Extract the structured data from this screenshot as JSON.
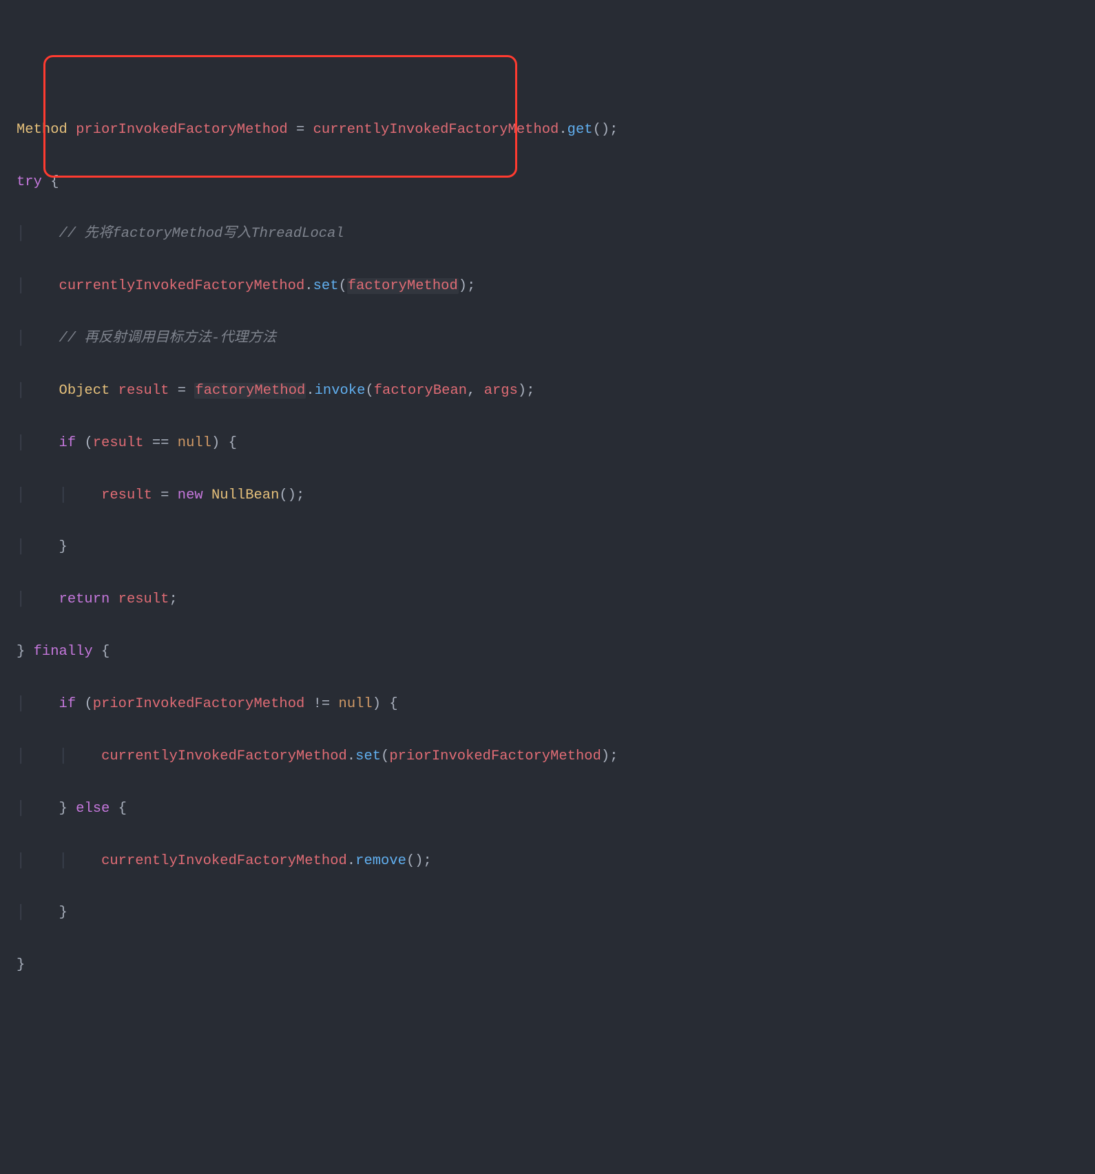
{
  "code": {
    "line1": {
      "type": "Method",
      "ident": "priorInvokedFactoryMethod",
      "eq": " = ",
      "obj": "currentlyInvokedFactoryMethod",
      "dot": ".",
      "method": "get",
      "call": "();"
    },
    "line2": {
      "kw": "try",
      "brace": " {"
    },
    "line3": {
      "comment": "// 先将factoryMethod写入ThreadLocal"
    },
    "line4": {
      "obj": "currentlyInvokedFactoryMethod",
      "dot": ".",
      "method": "set",
      "open": "(",
      "param": "factoryMethod",
      "close": ");"
    },
    "line5": {
      "comment": "// 再反射调用目标方法-代理方法"
    },
    "line6": {
      "type": "Object",
      "ident": "result",
      "eq": " = ",
      "obj": "factoryMethod",
      "dot": ".",
      "method": "invoke",
      "open": "(",
      "p1": "factoryBean",
      "comma": ", ",
      "p2": "args",
      "close": ");"
    },
    "line7": {
      "kw": "if",
      "open": " (",
      "ident": "result",
      "op": " == ",
      "null": "null",
      "close": ") {"
    },
    "line8": {
      "ident": "result",
      "eq": " = ",
      "new": "new",
      "sp": " ",
      "ctor": "NullBean",
      "call": "();"
    },
    "line9": {
      "brace": "}"
    },
    "line10": {
      "kw": "return",
      "sp": " ",
      "ident": "result",
      "semi": ";"
    },
    "line11": {
      "close": "}",
      "sp": " ",
      "kw": "finally",
      "brace": " {"
    },
    "line12": {
      "kw": "if",
      "open": " (",
      "ident": "priorInvokedFactoryMethod",
      "op": " != ",
      "null": "null",
      "close": ") {"
    },
    "line13": {
      "obj": "currentlyInvokedFactoryMethod",
      "dot": ".",
      "method": "set",
      "open": "(",
      "param": "priorInvokedFactoryMethod",
      "close": ");"
    },
    "line14": {
      "close": "}",
      "sp": " ",
      "kw": "else",
      "brace": " {"
    },
    "line15": {
      "obj": "currentlyInvokedFactoryMethod",
      "dot": ".",
      "method": "remove",
      "call": "();"
    },
    "line16": {
      "brace": "}"
    },
    "line17": {
      "brace": "}"
    }
  },
  "highlight": {
    "color": "#ff3b30"
  }
}
